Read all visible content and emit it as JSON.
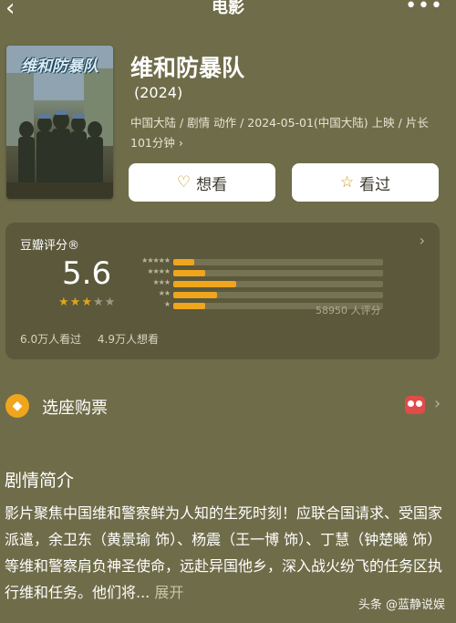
{
  "nav": {
    "back_glyph": "‹",
    "title": "电影",
    "more_glyph": "•••"
  },
  "movie": {
    "poster_title": "维和防暴队",
    "title": "维和防暴队",
    "year": "(2024)",
    "meta": "中国大陆 / 剧情 动作 / 2024-05-01(中国大陆) 上映 / 片长101分钟 ›"
  },
  "actions": {
    "want_label": "想看",
    "seen_label": "看过",
    "want_icon": "heart-plus-icon",
    "seen_icon": "star-icon"
  },
  "rating": {
    "label": "豆瓣评分®",
    "score": "5.6",
    "stars_value": 3,
    "stars_max": 5,
    "distribution": [
      {
        "stars": "★★★★★",
        "fraction": 0.1
      },
      {
        "stars": "★★★★",
        "fraction": 0.15
      },
      {
        "stars": "★★★",
        "fraction": 0.3
      },
      {
        "stars": "★★",
        "fraction": 0.21
      },
      {
        "stars": "★",
        "fraction": 0.15
      }
    ],
    "count": "58950 人评分",
    "watched": "6.0万人看过",
    "want": "4.9万人想看"
  },
  "ticket": {
    "label": "选座购票",
    "icon": "ticket-icon",
    "chevron": "›"
  },
  "synopsis": {
    "heading": "剧情简介",
    "text": "影片聚焦中国维和警察鲜为人知的生死时刻！应联合国请求、受国家派遣，余卫东（黄景瑜 饰）、杨震（王一博 饰）、丁慧（钟楚曦 饰）等维和警察肩负神圣使命，远赴异国他乡，深入战火纷飞的任务区执行维和任务。他们将...",
    "expand_label": "展开"
  },
  "watermark": "头条 @蓝静说娱",
  "colors": {
    "background": "#6f6c49",
    "card": "#5b583b",
    "accent": "#efa51c",
    "button": "#ffffff"
  }
}
